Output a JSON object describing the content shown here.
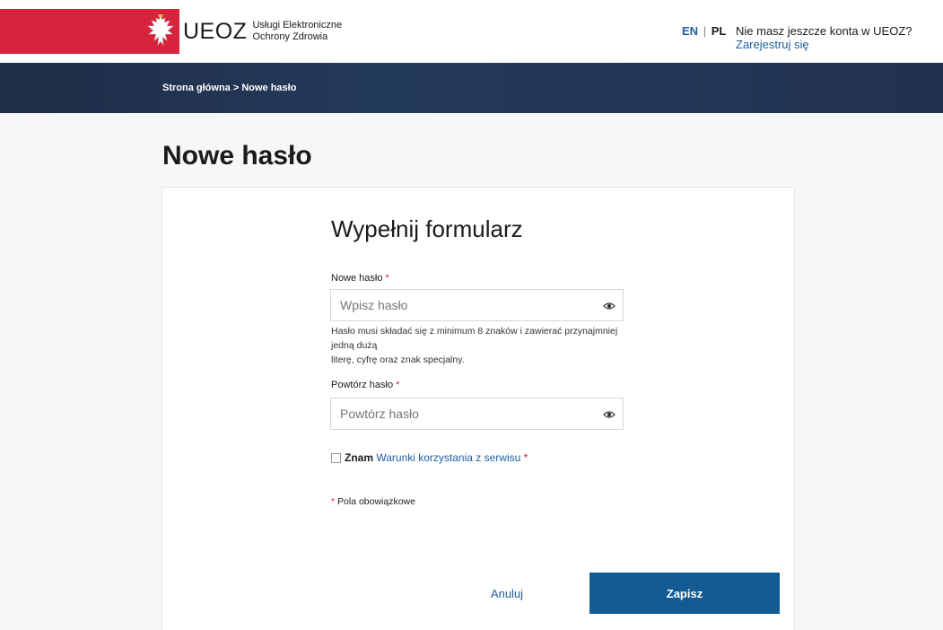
{
  "header": {
    "logo_text": "UEOZ",
    "logo_sub_line1": "Usługi Elektroniczne",
    "logo_sub_line2": "Ochrony Zdrowia",
    "lang_en": "EN",
    "lang_sep": "|",
    "lang_pl": "PL",
    "register_prompt": "Nie masz jeszcze konta w UEOZ? ",
    "register_link": "Zarejestruj się"
  },
  "breadcrumb": "Strona główna > Nowe hasło",
  "page_title": "Nowe hasło",
  "form": {
    "title": "Wypełnij formularz",
    "new_password_label": "Nowe hasło",
    "new_password_placeholder": "Wpisz hasło",
    "hint_line1": "Hasło musi składać się z minimum 8 znaków i zawierać przynajmniej jedną dużą",
    "hint_line2": "literę, cyfrę oraz znak specjalny.",
    "repeat_password_label": "Powtórz hasło",
    "repeat_password_placeholder": "Powtórz hasło",
    "terms_prefix": "Znam ",
    "terms_link": "Warunki korzystania z serwisu",
    "required_star": "*",
    "required_note": "Pola obowiązkowe",
    "cancel_label": "Anuluj",
    "save_label": "Zapisz"
  },
  "colors": {
    "brand_red": "#d7233c",
    "nav_dark": "#1f2d46",
    "link_blue": "#1f5fa0",
    "primary_button": "#135b94"
  }
}
